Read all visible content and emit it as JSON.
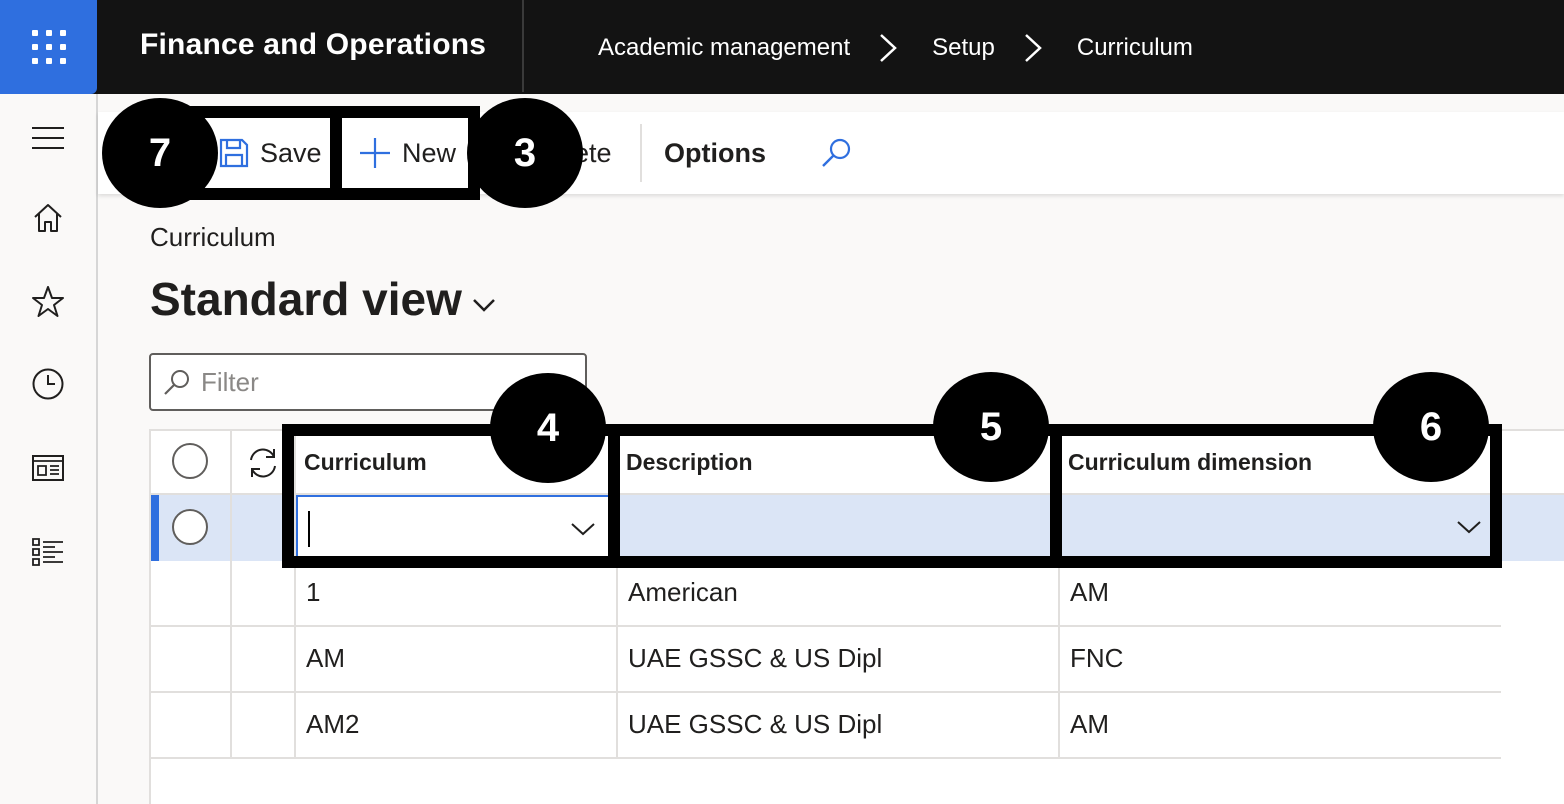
{
  "topbar": {
    "app_title": "Finance and Operations",
    "breadcrumbs": [
      "Academic management",
      "Setup",
      "Curriculum"
    ]
  },
  "toolbar": {
    "save_label": "Save",
    "new_label": "New",
    "delete_label": "ete",
    "options_label": "Options"
  },
  "page": {
    "caption": "Curriculum",
    "view_name": "Standard view"
  },
  "filter": {
    "placeholder": "Filter"
  },
  "grid": {
    "columns": [
      "Curriculum",
      "Description",
      "Curriculum dimension"
    ],
    "new_row": {
      "curriculum": "",
      "description": "",
      "dimension": ""
    },
    "rows": [
      {
        "curriculum": "1",
        "description": "American",
        "dimension": "AM"
      },
      {
        "curriculum": "AM",
        "description": "UAE GSSC & US Dipl",
        "dimension": "FNC"
      },
      {
        "curriculum": "AM2",
        "description": "UAE GSSC & US Dipl",
        "dimension": "AM"
      }
    ]
  },
  "callouts": [
    "7",
    "3",
    "4",
    "5",
    "6"
  ],
  "colors": {
    "accent": "#2f6fdf",
    "topbar": "#131313",
    "selected_row": "#dbe5f6"
  }
}
